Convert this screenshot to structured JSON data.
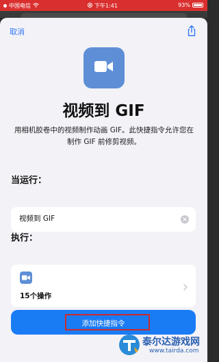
{
  "status_bar": {
    "carrier": "中国电信",
    "time": "下午1:41",
    "battery": "93%"
  },
  "header": {
    "cancel_label": "取消",
    "share_icon": "share-icon"
  },
  "shortcut": {
    "title": "视频到 GIF",
    "description": "用相机胶卷中的视频制作动画 GIF。此快捷指令允许您在制作 GIF 前修剪视频。",
    "icon": "video-camera-icon",
    "icon_color": "#5e8fd6"
  },
  "when_run": {
    "label": "当运行：",
    "name_value": "视频到 GIF"
  },
  "execute": {
    "label": "执行：",
    "action_count": "15个操作"
  },
  "add_button": {
    "label": "添加快捷指令",
    "color": "#1a7cf5"
  },
  "watermark": {
    "title": "泰尔达游戏网",
    "url": "www.tairda.com"
  },
  "colors": {
    "status_bar": "#d9302f",
    "accent": "#3478f6",
    "highlight_frame": "#cc2a2a"
  }
}
